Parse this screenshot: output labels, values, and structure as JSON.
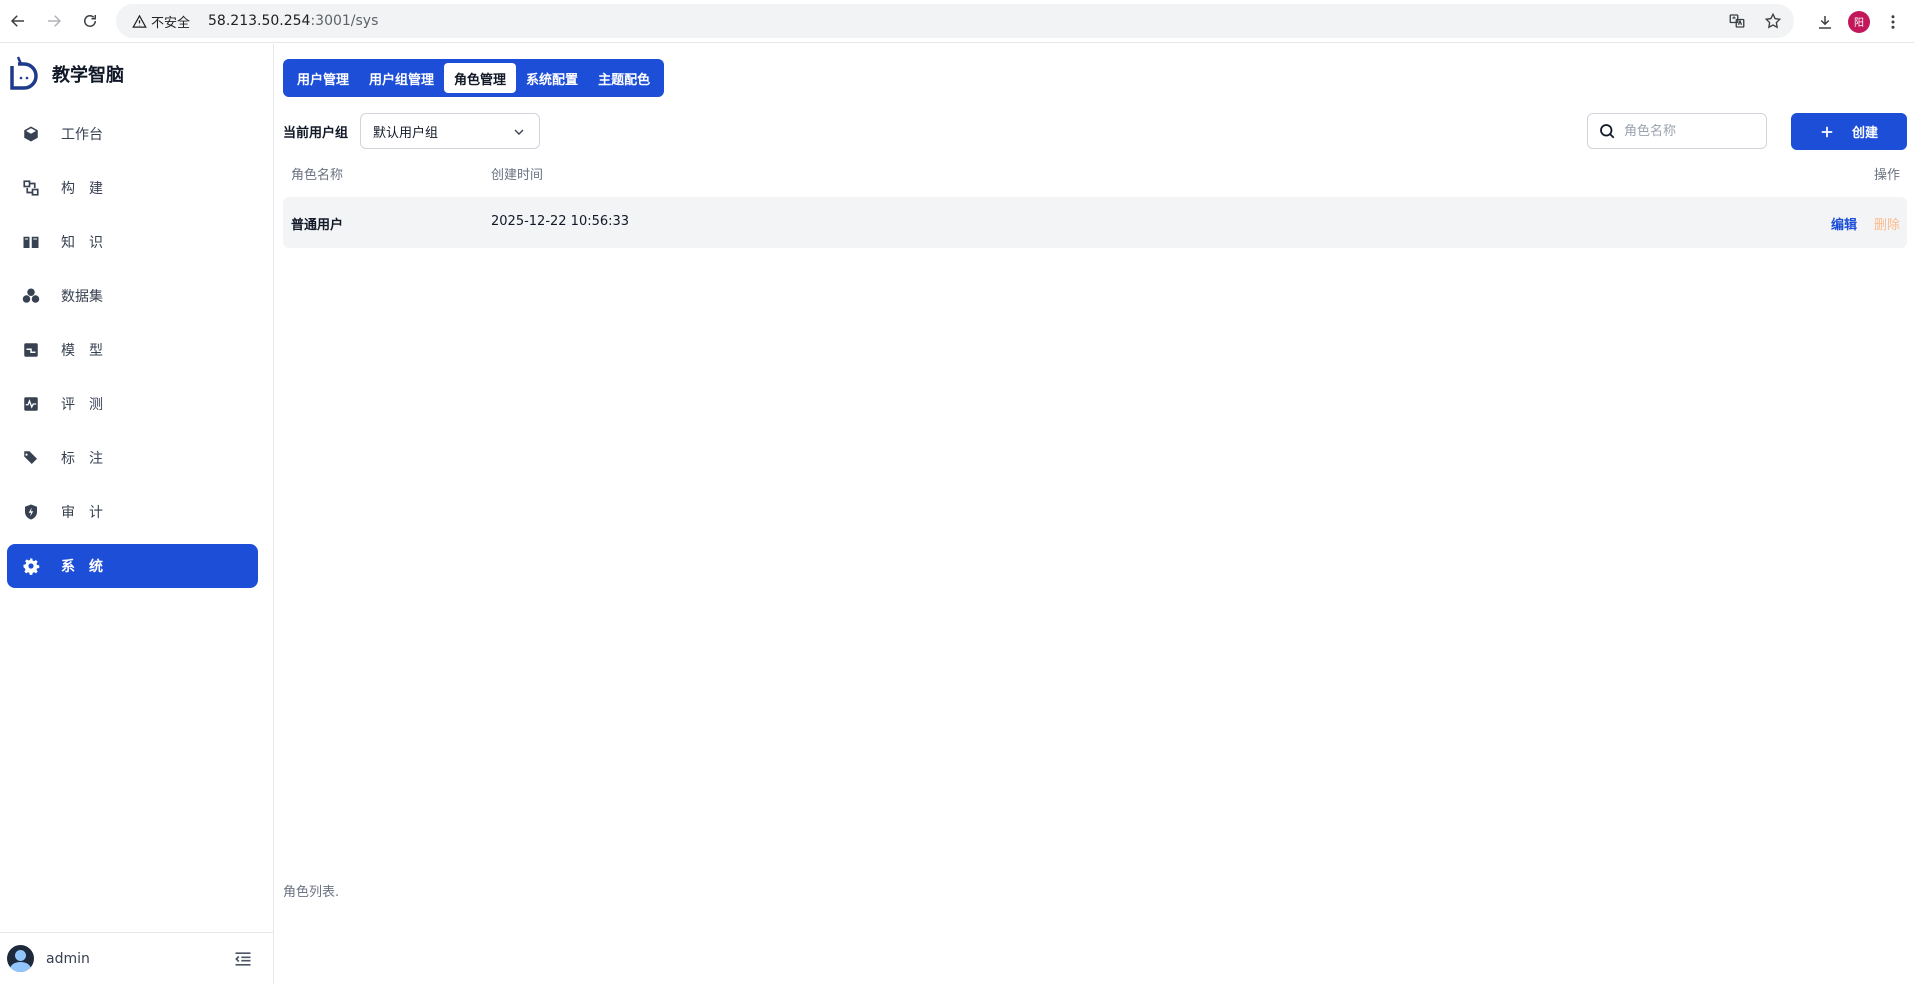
{
  "browser": {
    "insecure_label": "不安全",
    "url_host": "58.213.50.254",
    "url_path": ":3001/sys",
    "profile_initial": "阳"
  },
  "brand": {
    "name": "教学智脑"
  },
  "sidebar": {
    "items": [
      {
        "label": "工作台",
        "icon": "cube-icon"
      },
      {
        "label": "构建",
        "icon": "build-icon"
      },
      {
        "label": "知识",
        "icon": "book-icon"
      },
      {
        "label": "数据集",
        "icon": "dataset-icon"
      },
      {
        "label": "模型",
        "icon": "model-icon"
      },
      {
        "label": "评测",
        "icon": "pulse-icon"
      },
      {
        "label": "标注",
        "icon": "tags-icon"
      },
      {
        "label": "审计",
        "icon": "shield-icon"
      },
      {
        "label": "系统",
        "icon": "gear-icon"
      }
    ],
    "active_index": 8,
    "user": "admin"
  },
  "tabs": [
    {
      "label": "用户管理"
    },
    {
      "label": "用户组管理"
    },
    {
      "label": "角色管理"
    },
    {
      "label": "系统配置"
    },
    {
      "label": "主题配色"
    }
  ],
  "active_tab": 2,
  "filter": {
    "group_label": "当前用户组",
    "group_value": "默认用户组",
    "search_placeholder": "角色名称",
    "create_label": "创建"
  },
  "table": {
    "headers": {
      "name": "角色名称",
      "created": "创建时间",
      "actions": "操作"
    },
    "rows": [
      {
        "name": "普通用户",
        "created": "2025-12-22 10:56:33",
        "edit": "编辑",
        "delete": "删除"
      }
    ],
    "caption": "角色列表."
  },
  "colors": {
    "primary": "#1d4ed8",
    "delete": "#fdba8c"
  }
}
